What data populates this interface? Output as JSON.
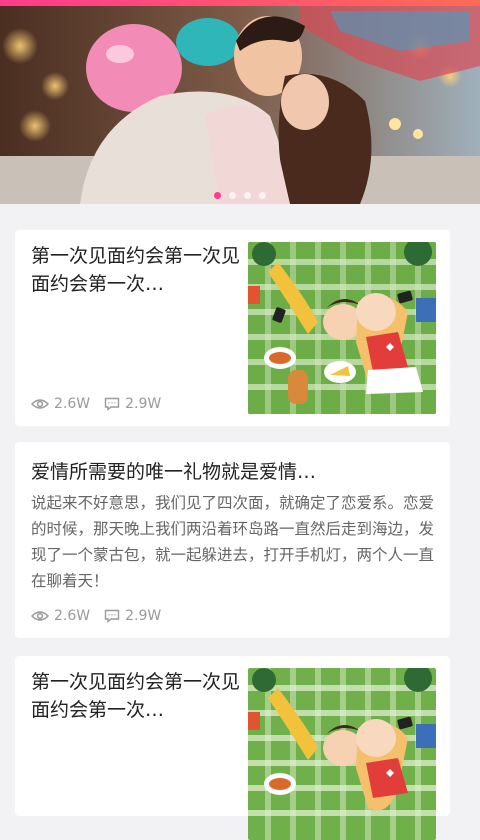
{
  "banner": {
    "image_icon": "couple-photo",
    "dot_count": 4,
    "active_dot": 0
  },
  "articles": [
    {
      "title": "第一次见面约会第一次见面约会第一次…",
      "views": "2.6W",
      "comments": "2.9W",
      "thumb_icon": "picnic-illustration"
    },
    {
      "title": "爱情所需要的唯一礼物就是爱情…",
      "excerpt": "说起来不好意思，我们见了四次面，就确定了恋爱系。恋爱的时候，那天晚上我们两沿着环岛路一直然后走到海边，发现了一个蒙古包，就一起躲进去，打开手机灯，两个人一直在聊着天！",
      "views": "2.6W",
      "comments": "2.9W"
    },
    {
      "title": "第一次见面约会第一次见面约会第一次…",
      "thumb_icon": "picnic-illustration"
    }
  ],
  "colors": {
    "accent": "#ff3c8c",
    "background": "#f2f2f4",
    "card": "#ffffff",
    "meta_text": "#9a9a9a"
  }
}
